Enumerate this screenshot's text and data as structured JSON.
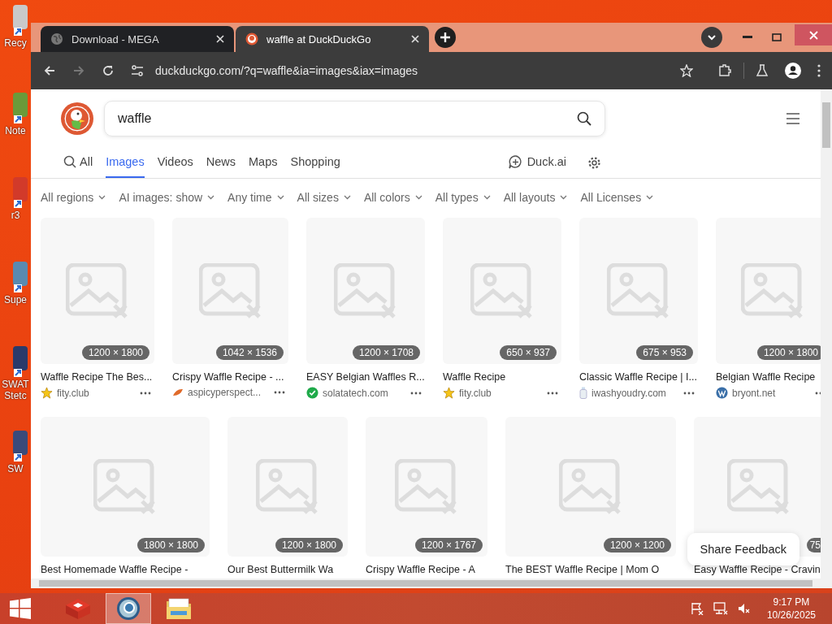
{
  "desktop_icons": [
    {
      "label": "Recy"
    },
    {
      "label": "Note"
    },
    {
      "label": "r3"
    },
    {
      "label": "Supe"
    },
    {
      "label": "SWAT Stetc"
    },
    {
      "label": "SW"
    }
  ],
  "browser": {
    "tabs": [
      {
        "title": "Download - MEGA",
        "kind": "globe",
        "selected": false
      },
      {
        "title": "waffle at DuckDuckGo",
        "kind": "duckduckgo",
        "selected": true
      }
    ],
    "address": "duckduckgo.com/?q=waffle&ia=images&iax=images"
  },
  "page": {
    "search": {
      "value": "waffle"
    },
    "nav": [
      {
        "label": "All",
        "selected": false
      },
      {
        "label": "Images",
        "selected": true
      },
      {
        "label": "Videos",
        "selected": false
      },
      {
        "label": "News",
        "selected": false
      },
      {
        "label": "Maps",
        "selected": false
      },
      {
        "label": "Shopping",
        "selected": false
      }
    ],
    "duck_ai": "Duck.ai",
    "filters": [
      "All regions",
      "AI images: show",
      "Any time",
      "All sizes",
      "All colors",
      "All types",
      "All layouts",
      "All Licenses"
    ],
    "results": [
      {
        "dims": "1200 × 1800",
        "title": "Waffle Recipe The Bes...",
        "source": {
          "kind": "star",
          "label": "fity.club"
        }
      },
      {
        "dims": "1042 × 1536",
        "title": "Crispy Waffle Recipe - ...",
        "source": {
          "kind": "leaf",
          "label": "aspicyperspect..."
        }
      },
      {
        "dims": "1200 × 1708",
        "title": "EASY Belgian Waffles R...",
        "source": {
          "kind": "check",
          "label": "solatatech.com"
        }
      },
      {
        "dims": "650 × 937",
        "title": "Waffle Recipe",
        "source": {
          "kind": "star",
          "label": "fity.club"
        }
      },
      {
        "dims": "675 × 953",
        "title": "Classic Waffle Recipe | I...",
        "source": {
          "kind": "bottle",
          "label": "iwashyoudry.com"
        }
      },
      {
        "dims": "1200 × 1800",
        "title": "Belgian Waffle Recipe",
        "source": {
          "kind": "wordpress",
          "label": "bryont.net"
        }
      },
      {
        "dims": "1800 × 1800",
        "title": "Best Homemade Waffle Recipe -"
      },
      {
        "dims": "1200 × 1800",
        "title": "Our Best Buttermilk Wa"
      },
      {
        "dims": "1200 × 1767",
        "title": "Crispy Waffle Recipe - A"
      },
      {
        "dims": "1200 × 1200",
        "title": "The BEST Waffle Recipe | Mom O"
      },
      {
        "dims": "75",
        "title": "Easy Waffle Recipe - Cravin"
      }
    ],
    "share_feedback": "Share Feedback"
  },
  "taskbar": {
    "apps": [
      {
        "kind": "mega",
        "selected": false
      },
      {
        "kind": "chrome",
        "selected": true
      },
      {
        "kind": "explorer",
        "selected": false
      }
    ],
    "time": "9:17 PM",
    "date": "10/26/2025"
  }
}
